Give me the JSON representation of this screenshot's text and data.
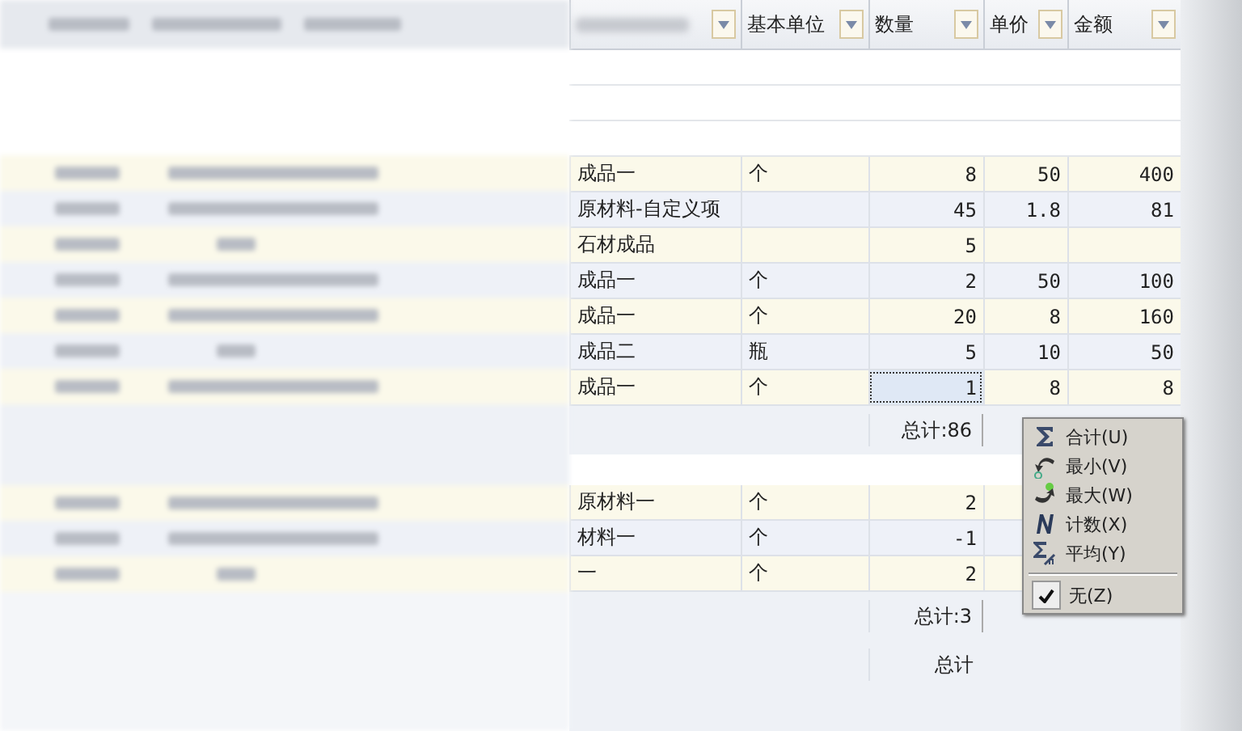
{
  "table": {
    "columns": [
      {
        "label": "基本单位"
      },
      {
        "label": "数量"
      },
      {
        "label": "单价"
      },
      {
        "label": "金额"
      }
    ],
    "groups": [
      {
        "rows": [
          {
            "name": "成品一",
            "unit": "个",
            "qty": "8",
            "price": "50",
            "amount": "400",
            "selected": false
          },
          {
            "name": "原材料-自定义项",
            "qty": "45",
            "price": "1.8",
            "amount": "81",
            "selected": false
          },
          {
            "name": "石材成品",
            "qty": "5",
            "selected": false
          },
          {
            "name": "成品一",
            "unit": "个",
            "qty": "2",
            "price": "50",
            "amount": "100",
            "selected": false
          },
          {
            "name": "成品一",
            "unit": "个",
            "qty": "20",
            "price": "8",
            "amount": "160",
            "selected": false
          },
          {
            "name": "成品二",
            "unit": "瓶",
            "qty": "5",
            "price": "10",
            "amount": "50",
            "selected": false
          },
          {
            "name": "成品一",
            "unit": "个",
            "qty": "1",
            "price": "8",
            "amount": "8",
            "selected": true
          }
        ],
        "total": "总计:86"
      },
      {
        "rows": [
          {
            "name": "原材料一",
            "unit": "个",
            "qty": "2",
            "selected": false
          },
          {
            "name": "材料一",
            "unit": "个",
            "qty": "-1",
            "selected": false
          },
          {
            "name": "一",
            "unit": "个",
            "qty": "2",
            "selected": false
          }
        ],
        "total": "总计:3"
      }
    ],
    "footer_total": "总计"
  },
  "context_menu": {
    "items": [
      {
        "kind": "sum",
        "label": "合计(U)",
        "checked": false
      },
      {
        "kind": "min",
        "label": "最小(V)",
        "checked": false
      },
      {
        "kind": "max",
        "label": "最大(W)",
        "checked": false
      },
      {
        "kind": "count",
        "label": "计数(X)",
        "checked": false
      },
      {
        "kind": "average",
        "label": "平均(Y)",
        "checked": false
      },
      {
        "kind": "none",
        "label": "无(Z)",
        "checked": true
      }
    ]
  }
}
